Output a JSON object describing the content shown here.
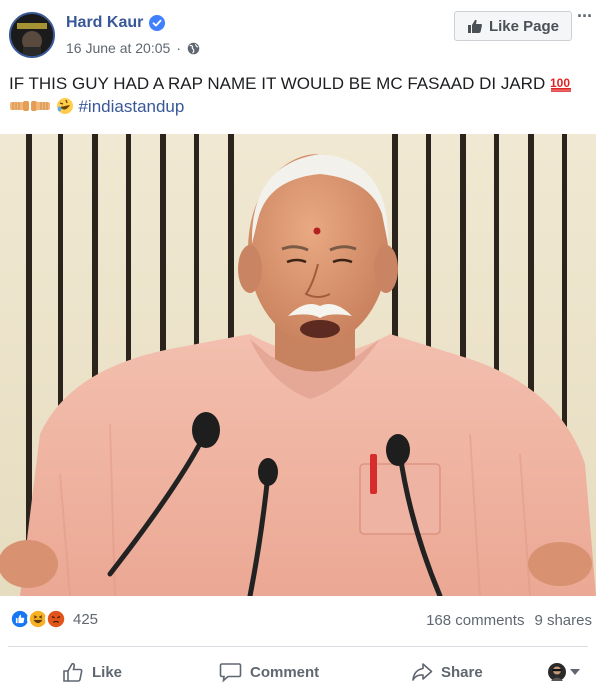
{
  "post": {
    "author": "Hard Kaur",
    "date": "16 June at 20:05",
    "separator": "·",
    "like_page_label": "Like Page",
    "text": "IF THIS GUY HAD A RAP NAME IT WOULD BE MC FASAAD DI JARD",
    "hashtag": "#indiastandup"
  },
  "stats": {
    "reaction_count": "425",
    "comments": "168 comments",
    "shares": "9 shares"
  },
  "actions": {
    "like": "Like",
    "comment": "Comment",
    "share": "Share"
  },
  "colors": {
    "link": "#385898",
    "muted": "#606770",
    "like_blue": "#1877f2",
    "haha_yellow": "#f7b125",
    "angry_red": "#e9710f"
  },
  "icons": [
    "verified-badge-icon",
    "globe-icon",
    "thumbs-up-icon",
    "more-options-icon",
    "hundred-points-emoji",
    "fist-bump-emoji",
    "rolling-laughing-emoji",
    "like-reaction-icon",
    "haha-reaction-icon",
    "angry-reaction-icon",
    "comment-icon",
    "share-icon",
    "chevron-down-icon"
  ]
}
